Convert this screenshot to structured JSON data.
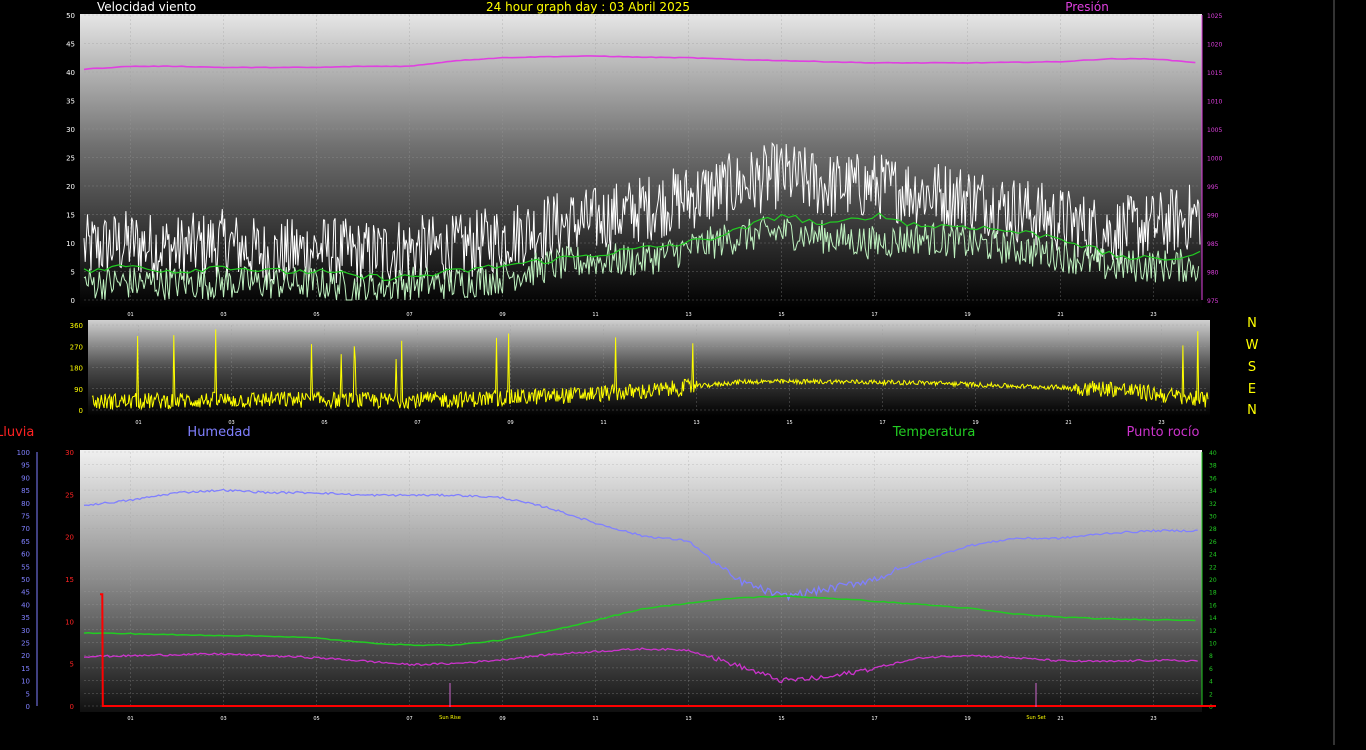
{
  "header": {
    "wind_title": "Velocidad viento",
    "graph_title": "24 hour graph day : 03 Abril 2025",
    "pressure_title": "Presión"
  },
  "compass": [
    "N",
    "W",
    "S",
    "E",
    "N"
  ],
  "lower_titles": {
    "rain": "Lluvia",
    "humidity": "Humedad",
    "temperature": "Temperatura",
    "dewpoint": "Punto rocío"
  },
  "annotations": {
    "sunrise": "Sun Rise",
    "sunset": "Sun Set"
  },
  "colors": {
    "background": "#000000",
    "wind_speed": "#ffffff",
    "wind_avg": "#bff2c0",
    "wind_dir": "#ffff00",
    "pressure": "#e040e0",
    "humidity": "#8080ff",
    "temperature": "#22cc22",
    "dewpoint": "#cc33cc",
    "rain": "#ff0000",
    "title_yellow": "#ffff00"
  },
  "chart_data": [
    {
      "id": "wind",
      "type": "line",
      "x_ticks": [
        "01",
        "03",
        "05",
        "07",
        "09",
        "11",
        "13",
        "15",
        "17",
        "19",
        "21",
        "23"
      ],
      "y_left_ticks": [
        0,
        5,
        10,
        15,
        20,
        25,
        30,
        35,
        40,
        45,
        50
      ],
      "y_right_ticks": [
        975,
        980,
        985,
        990,
        995,
        1000,
        1005,
        1010,
        1015,
        1020,
        1025
      ],
      "ylim_left": [
        0,
        50
      ],
      "ylim_right": [
        975,
        1025
      ],
      "series": [
        {
          "name": "Velocidad viento",
          "hours": [
            0,
            1,
            2,
            3,
            4,
            5,
            6,
            7,
            8,
            9,
            10,
            11,
            12,
            13,
            14,
            15,
            16,
            17,
            18,
            19,
            20,
            21,
            22,
            23,
            24
          ],
          "values": [
            9,
            10,
            9,
            10,
            8,
            9,
            8,
            9,
            9,
            11,
            13,
            14,
            16,
            18,
            20,
            22,
            20,
            20,
            19,
            18,
            16,
            14,
            12,
            13,
            15
          ]
        },
        {
          "name": "",
          "hours": [
            0,
            1,
            2,
            3,
            4,
            5,
            6,
            7,
            8,
            9,
            10,
            11,
            12,
            13,
            14,
            15,
            16,
            17,
            18,
            19,
            20,
            21,
            22,
            23,
            24
          ],
          "values": [
            3,
            3,
            3,
            3,
            3,
            3,
            2,
            3,
            3,
            4,
            6,
            7,
            7,
            9,
            11,
            12,
            11,
            10,
            11,
            10,
            9,
            8,
            6,
            6,
            6
          ]
        },
        {
          "name": "Presión",
          "hours": [
            0,
            1,
            2,
            3,
            4,
            5,
            6,
            7,
            8,
            9,
            10,
            11,
            12,
            13,
            14,
            15,
            16,
            17,
            18,
            19,
            20,
            21,
            22,
            23,
            24
          ],
          "values": [
            1015.5,
            1016,
            1016,
            1015.8,
            1015.8,
            1015.8,
            1016,
            1016,
            1017,
            1017.5,
            1017.7,
            1017.8,
            1017.6,
            1017.5,
            1017.2,
            1017,
            1016.8,
            1016.6,
            1016.6,
            1016.6,
            1016.7,
            1016.8,
            1017.3,
            1017.3,
            1016.6
          ]
        },
        {
          "name": "",
          "hours": [
            0,
            1,
            2,
            3,
            4,
            5,
            6,
            7,
            8,
            9,
            10,
            11,
            12,
            13,
            14,
            15,
            16,
            17,
            18,
            19,
            20,
            21,
            22,
            23,
            24
          ],
          "values": [
            5,
            6,
            5,
            6,
            5,
            5,
            4,
            4,
            5,
            6,
            7,
            8,
            9,
            10,
            12,
            15,
            13,
            15,
            13,
            13,
            12,
            11,
            8,
            7,
            8
          ]
        }
      ]
    },
    {
      "id": "wind_direction",
      "type": "line",
      "x_ticks": [
        "01",
        "03",
        "05",
        "07",
        "09",
        "11",
        "13",
        "15",
        "17",
        "19",
        "21",
        "23"
      ],
      "y_ticks": [
        0,
        90,
        180,
        270,
        360
      ],
      "ylim": [
        0,
        360
      ],
      "series": [
        {
          "name": "",
          "hours": [
            0,
            2,
            4,
            6,
            8,
            10,
            12,
            13,
            14,
            16,
            18,
            20,
            22,
            24
          ],
          "values": [
            35,
            40,
            45,
            40,
            45,
            60,
            80,
            100,
            120,
            120,
            115,
            100,
            90,
            40
          ]
        }
      ]
    },
    {
      "id": "temp_humidity",
      "type": "line",
      "x_ticks": [
        "01",
        "03",
        "05",
        "07",
        "09",
        "11",
        "13",
        "15",
        "17",
        "19",
        "21",
        "23"
      ],
      "rain_ticks": [
        0,
        5,
        10,
        15,
        20,
        25,
        30
      ],
      "humidity_ticks": [
        0,
        5,
        10,
        15,
        20,
        25,
        30,
        35,
        40,
        45,
        50,
        55,
        60,
        65,
        70,
        75,
        80,
        85,
        90,
        95,
        100
      ],
      "temp_ticks": [
        0,
        2,
        4,
        6,
        8,
        10,
        12,
        14,
        16,
        18,
        20,
        22,
        24,
        26,
        28,
        30,
        32,
        34,
        36,
        38,
        40
      ],
      "ylim_rain": [
        0,
        30
      ],
      "ylim_humidity": [
        0,
        100
      ],
      "ylim_temperature": [
        0,
        40
      ],
      "series": [
        {
          "name": "Humedad",
          "hours": [
            0,
            1,
            2,
            3,
            4,
            5,
            6,
            7,
            8,
            9,
            10,
            11,
            12,
            13,
            14,
            15,
            16,
            17,
            18,
            19,
            20,
            21,
            22,
            23,
            24
          ],
          "values": [
            79,
            81,
            84,
            85,
            84,
            84,
            83,
            83,
            83,
            82,
            78,
            72,
            67,
            65,
            50,
            43,
            46,
            50,
            57,
            63,
            66,
            66,
            68,
            69,
            69
          ]
        },
        {
          "name": "Temperatura",
          "hours": [
            0,
            1,
            2,
            3,
            4,
            5,
            6,
            7,
            8,
            9,
            10,
            11,
            12,
            13,
            14,
            15,
            16,
            17,
            18,
            19,
            20,
            21,
            22,
            23,
            24
          ],
          "values": [
            11.5,
            11.4,
            11.2,
            11.1,
            11,
            10.7,
            10,
            9.6,
            9.6,
            10.4,
            11.8,
            13.5,
            15.3,
            16.2,
            17,
            17.3,
            17,
            16.5,
            16,
            15.4,
            14.5,
            14,
            13.7,
            13.6,
            13.5
          ]
        },
        {
          "name": "Punto rocío",
          "hours": [
            0,
            1,
            2,
            3,
            4,
            5,
            6,
            7,
            8,
            9,
            10,
            11,
            12,
            13,
            14,
            15,
            16,
            17,
            18,
            19,
            20,
            21,
            22,
            23,
            24
          ],
          "values": [
            7.8,
            7.9,
            8.1,
            8.2,
            7.9,
            7.6,
            7.1,
            6.5,
            6.7,
            7.3,
            8.1,
            8.6,
            9,
            8.8,
            6.5,
            4,
            4.5,
            6,
            7.6,
            8,
            7.6,
            7.1,
            7,
            7.2,
            7.1
          ]
        },
        {
          "name": "Lluvia",
          "hours": [
            0,
            0.05,
            0.06,
            24
          ],
          "values": [
            13.2,
            13.2,
            0,
            0
          ]
        }
      ]
    }
  ]
}
